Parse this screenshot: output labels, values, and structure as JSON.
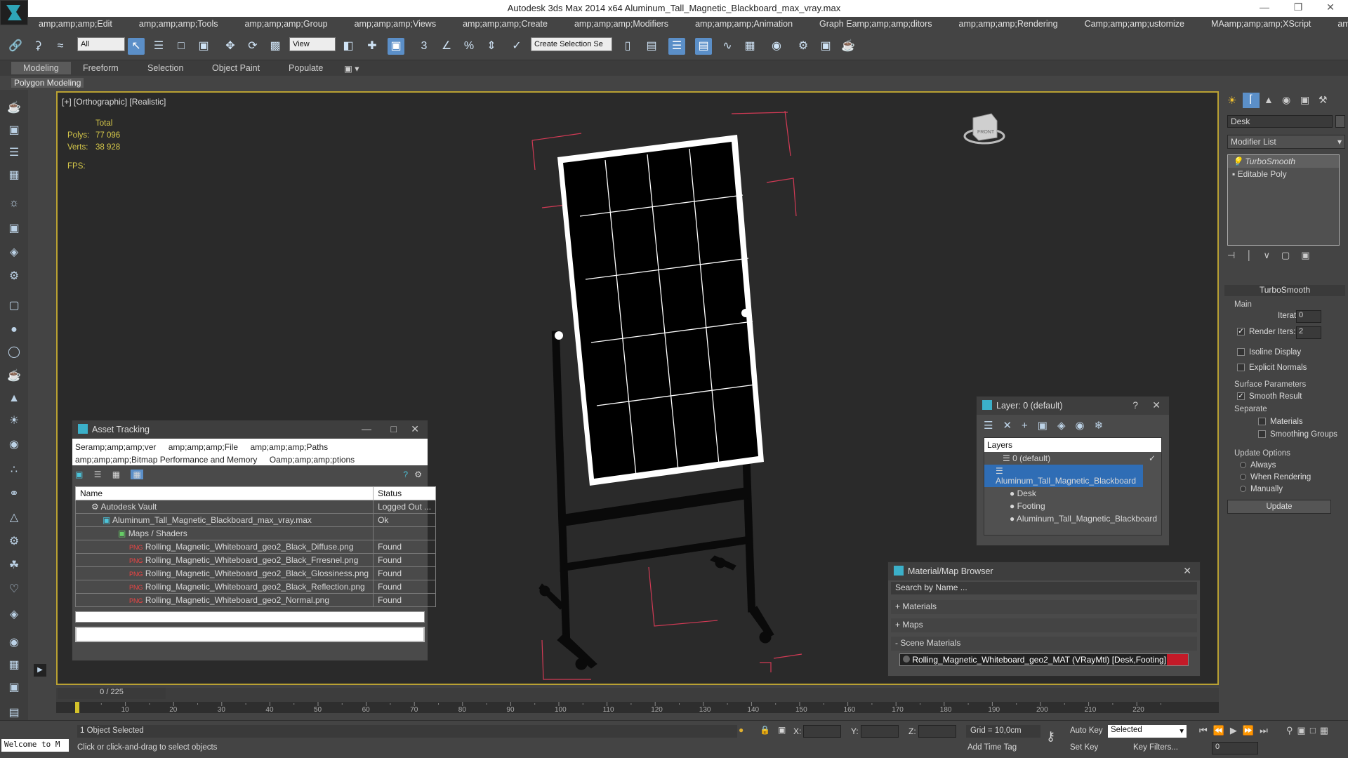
{
  "window": {
    "title": "Autodesk 3ds Max  2014 x64    Aluminum_Tall_Magnetic_Blackboard_max_vray.max"
  },
  "menu": [
    "amp;amp;amp;Edit",
    "amp;amp;amp;Tools",
    "amp;amp;amp;Group",
    "amp;amp;amp;Views",
    "amp;amp;amp;Create",
    "amp;amp;amp;Modifiers",
    "amp;amp;amp;Animation",
    "Graph Eamp;amp;amp;ditors",
    "amp;amp;amp;Rendering",
    "Camp;amp;amp;ustomize",
    "MAamp;amp;amp;XScript",
    "amp;amp;amp;Help"
  ],
  "toolbar": {
    "filter_value": "All",
    "refcoord_value": "View",
    "named_selection": "Create Selection Se"
  },
  "ribbon": {
    "tabs": [
      "Modeling",
      "Freeform",
      "Selection",
      "Object Paint",
      "Populate"
    ],
    "sub": "Polygon Modeling"
  },
  "viewport": {
    "label": "[+] [Orthographic] [Realistic]",
    "stats_total": "Total",
    "polys_label": "Polys:",
    "polys": "77 096",
    "verts_label": "Verts:",
    "verts": "38 928",
    "fps_label": "FPS:",
    "viewcube_label": "FRONT"
  },
  "asset_tracking": {
    "title": "Asset Tracking",
    "menus": [
      "Seramp;amp;amp;ver",
      "amp;amp;amp;File",
      "amp;amp;amp;Paths",
      "amp;amp;amp;Bitmap Performance and Memory",
      "Oamp;amp;amp;ptions"
    ],
    "col_name": "Name",
    "col_status": "Status",
    "rows": [
      {
        "name": "Autodesk Vault",
        "status": "Logged Out ..."
      },
      {
        "name": "Aluminum_Tall_Magnetic_Blackboard_max_vray.max",
        "status": "Ok"
      },
      {
        "name": "Maps / Shaders",
        "status": ""
      },
      {
        "name": "Rolling_Magnetic_Whiteboard_geo2_Black_Diffuse.png",
        "status": "Found"
      },
      {
        "name": "Rolling_Magnetic_Whiteboard_geo2_Black_Frresnel.png",
        "status": "Found"
      },
      {
        "name": "Rolling_Magnetic_Whiteboard_geo2_Black_Glossiness.png",
        "status": "Found"
      },
      {
        "name": "Rolling_Magnetic_Whiteboard_geo2_Black_Reflection.png",
        "status": "Found"
      },
      {
        "name": "Rolling_Magnetic_Whiteboard_geo2_Normal.png",
        "status": "Found"
      }
    ]
  },
  "layers": {
    "title": "Layer: 0 (default)",
    "header": "Layers",
    "items": [
      "0 (default)",
      "Aluminum_Tall_Magnetic_Blackboard",
      "Desk",
      "Footing",
      "Aluminum_Tall_Magnetic_Blackboard"
    ]
  },
  "material_browser": {
    "title": "Material/Map Browser",
    "search_placeholder": "Search by Name ...",
    "sections": [
      "+ Materials",
      "+ Maps",
      "- Scene Materials"
    ],
    "scene_material": "Rolling_Magnetic_Whiteboard_geo2_MAT  (VRayMtl) [Desk,Footing]"
  },
  "command_panel": {
    "object_name": "Desk",
    "modifier_list": "Modifier List",
    "stack": [
      "TurboSmooth",
      "Editable Poly"
    ],
    "rollout": "TurboSmooth",
    "main": "Main",
    "iterations_label": "Iterations:",
    "iterations": "0",
    "render_iters_label": "Render Iters:",
    "render_iters": "2",
    "isoline": "Isoline Display",
    "explicit": "Explicit Normals",
    "surface": "Surface Parameters",
    "smooth": "Smooth Result",
    "separate": "Separate",
    "materials": "Materials",
    "smoothing": "Smoothing Groups",
    "update_options": "Update Options",
    "always": "Always",
    "when_rendering": "When Rendering",
    "manually": "Manually",
    "update_btn": "Update"
  },
  "timeline": {
    "frame": "0 / 225",
    "ticks": [
      "10",
      "20",
      "30",
      "40",
      "50",
      "60",
      "70",
      "80",
      "90",
      "100",
      "110",
      "120",
      "130",
      "140",
      "150",
      "160",
      "170",
      "180",
      "190",
      "200",
      "210",
      "220"
    ]
  },
  "status": {
    "selected": "1 Object Selected",
    "prompt": "Click or click-and-drag to select objects",
    "welcome": "Welcome to M",
    "x_label": "X:",
    "y_label": "Y:",
    "z_label": "Z:",
    "grid": "Grid = 10,0cm",
    "auto_key": "Auto Key",
    "set_key": "Set Key",
    "key_mode": "Selected",
    "add_time_tag": "Add Time Tag",
    "key_filters": "Key Filters...",
    "frame_field": "0"
  },
  "colors": {
    "accent": "#5b8fc8",
    "viewport_border": "#b9a133",
    "stats": "#d7c94a"
  }
}
